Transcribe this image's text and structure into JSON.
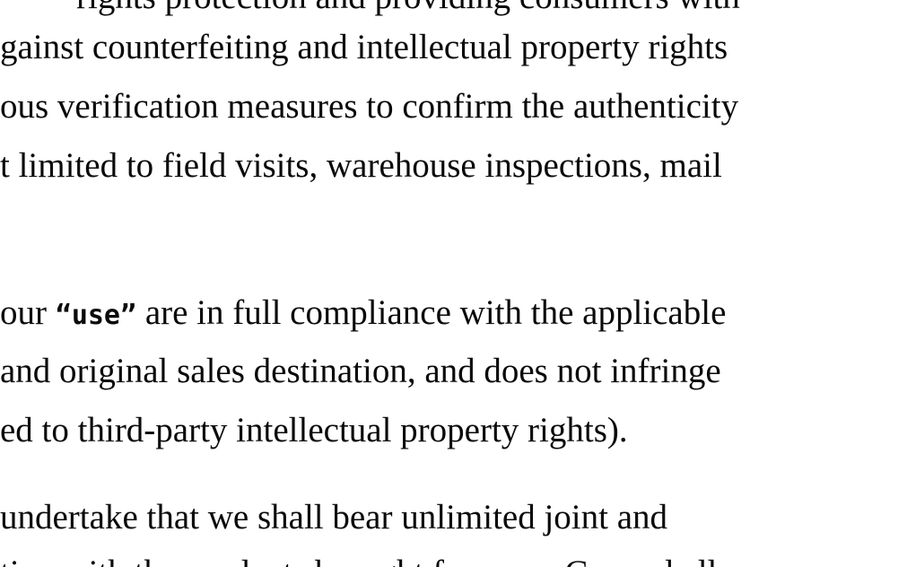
{
  "document": {
    "paragraph_1": {
      "lines": [
        "rights protection and providing consumers with",
        "gainst counterfeiting and intellectual property rights",
        "ous verification measures to confirm the authenticity",
        "t limited to field visits, warehouse inspections, mail"
      ]
    },
    "paragraph_2": {
      "line_1_before": "our ",
      "line_1_quote_open": "“",
      "line_1_quoted": "use",
      "line_1_quote_close": "”",
      "line_1_after": " are in full compliance with the applicable",
      "lines": [
        " and original sales destination, and does not infringe",
        "ed to third-party intellectual property rights)."
      ]
    },
    "paragraph_3": {
      "lines": [
        "undertake that we shall bear unlimited joint and",
        "tion with the products brought from our C... and all"
      ]
    }
  }
}
